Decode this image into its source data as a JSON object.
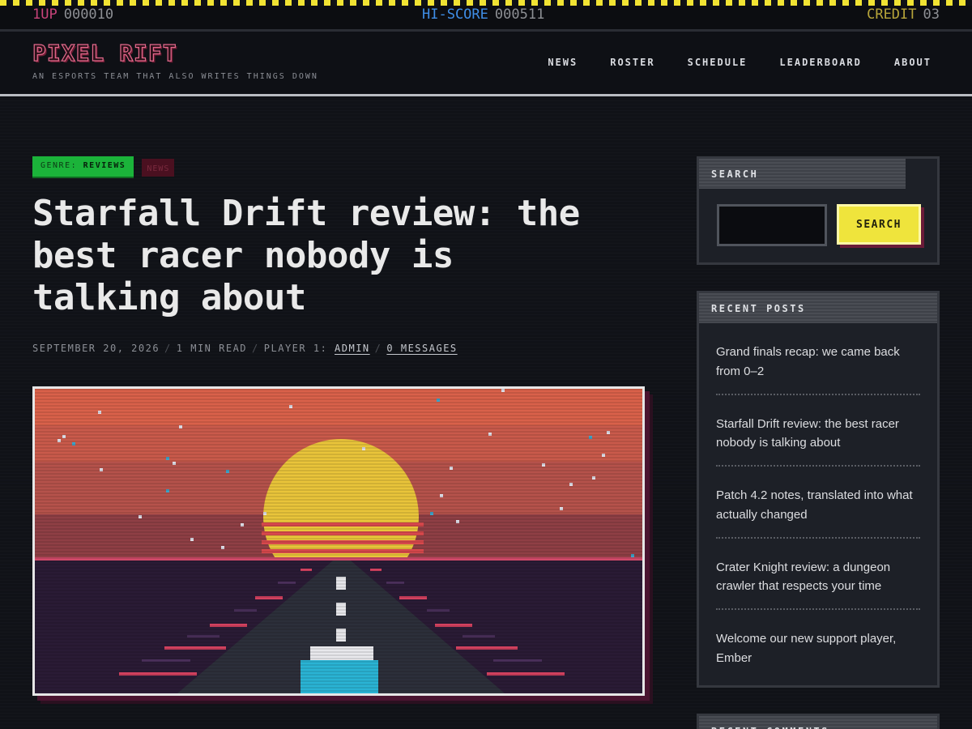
{
  "arcade_bar": {
    "p1_label": "1UP",
    "p1_score": "000010",
    "hi_label": "HI-SCORE",
    "hi_score": "000511",
    "credit_label": "CREDIT",
    "credit_count": "03"
  },
  "site": {
    "logo": "PIXEL RIFT",
    "tagline": "AN ESPORTS TEAM THAT ALSO WRITES THINGS DOWN"
  },
  "nav": [
    "NEWS",
    "ROSTER",
    "SCHEDULE",
    "LEADERBOARD",
    "ABOUT"
  ],
  "post": {
    "tag_genre_prefix": "GENRE:",
    "tag_genre": "REVIEWS",
    "tag_secondary": "NEWS",
    "title": "Starfall Drift review: the best racer nobody is talking about",
    "date": "SEPTEMBER 20, 2026",
    "read_time": "1 MIN READ",
    "author_prefix": "PLAYER 1:",
    "author": "ADMIN",
    "comments": "0 MESSAGES"
  },
  "sidebar": {
    "search_title": "SEARCH",
    "search_button": "SEARCH",
    "search_value": "",
    "recent_title": "RECENT POSTS",
    "recent_posts": [
      "Grand finals recap: we came back from 0–2",
      "Starfall Drift review: the best racer nobody is talking about",
      "Patch 4.2 notes, translated into what actually changed",
      "Crater Knight review: a dungeon crawler that respects your time",
      "Welcome our new support player, Ember"
    ],
    "comments_title": "RECENT COMMENTS"
  },
  "colors": {
    "hazard_yellow": "#f1e333",
    "accent_pink": "#e36a8d",
    "genre_green": "#1bb33a",
    "button_yellow": "#efe43c"
  }
}
